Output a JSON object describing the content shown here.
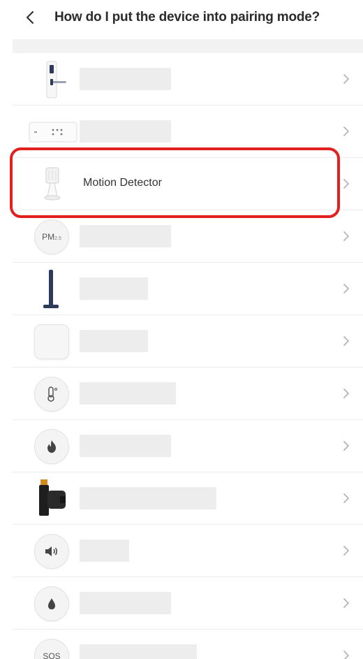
{
  "header": {
    "title": "How do I put the device into pairing mode?",
    "back_icon": "chevron-left-icon"
  },
  "devices": [
    {
      "icon": "door-lock-icon",
      "label": ""
    },
    {
      "icon": "wall-switch-icon",
      "label": ""
    },
    {
      "icon": "motion-detector-icon",
      "label": "Motion Detector"
    },
    {
      "icon": "pm25-sensor-icon",
      "label": ""
    },
    {
      "icon": "floor-stand-icon",
      "label": ""
    },
    {
      "icon": "white-square-hub-icon",
      "label": ""
    },
    {
      "icon": "thermometer-icon",
      "label": ""
    },
    {
      "icon": "flame-icon",
      "label": ""
    },
    {
      "icon": "valve-controller-icon",
      "label": ""
    },
    {
      "icon": "siren-speaker-icon",
      "label": ""
    },
    {
      "icon": "water-drop-icon",
      "label": ""
    },
    {
      "icon": "sos-icon",
      "label": ""
    }
  ],
  "icon_text": {
    "pm": "PM",
    "pm_sub": "2.5",
    "sos": "SOS"
  },
  "colors": {
    "highlight": "#e32020",
    "placeholder": "#ededed",
    "divider": "#ececec",
    "navy": "#2e3a5c"
  }
}
